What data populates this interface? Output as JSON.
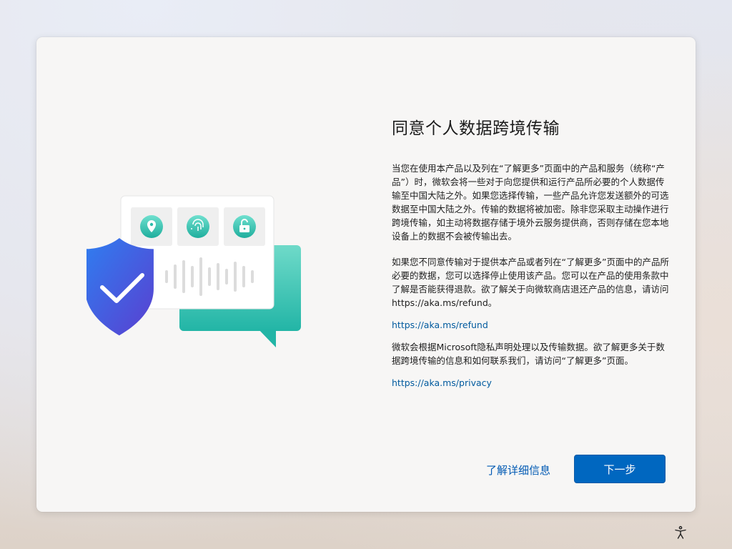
{
  "page": {
    "title": "同意个人数据跨境传输",
    "paragraphs": [
      "当您在使用本产品以及列在“了解更多”页面中的产品和服务（统称“产品”）时，微软会将一些对于向您提供和运行产品所必要的个人数据传输至中国大陆之外。如果您选择传输，一些产品允许您发送额外的可选数据至中国大陆之外。传输的数据将被加密。除非您采取主动操作进行跨境传输，如主动将数据存储于境外云服务提供商，否则存储在您本地设备上的数据不会被传输出去。",
      "如果您不同意传输对于提供本产品或者列在“了解更多”页面中的产品所必要的数据，您可以选择停止使用该产品。您可以在产品的使用条款中了解是否能获得退款。欲了解关于向微软商店退还产品的信息，请访问https://aka.ms/refund。",
      "微软会根据Microsoft隐私声明处理以及传输数据。欲了解更多关于数据跨境传输的信息和如何联系我们，请访问“了解更多”页面。"
    ],
    "refund_link": "https://aka.ms/refund",
    "privacy_link": "https://aka.ms/privacy"
  },
  "footer": {
    "learn_more_label": "了解详细信息",
    "next_label": "下一步"
  },
  "icons": {
    "illustration": [
      "location-pin-icon",
      "fingerprint-icon",
      "unlock-icon",
      "shield-check-icon",
      "chat-bubble-icon",
      "audio-waveform-icon"
    ],
    "accessibility": "accessibility-icon"
  },
  "colors": {
    "accent": "#0067c0",
    "link": "#005a9e",
    "shield": "#3c5be0",
    "teal": "#3cc9b8"
  }
}
